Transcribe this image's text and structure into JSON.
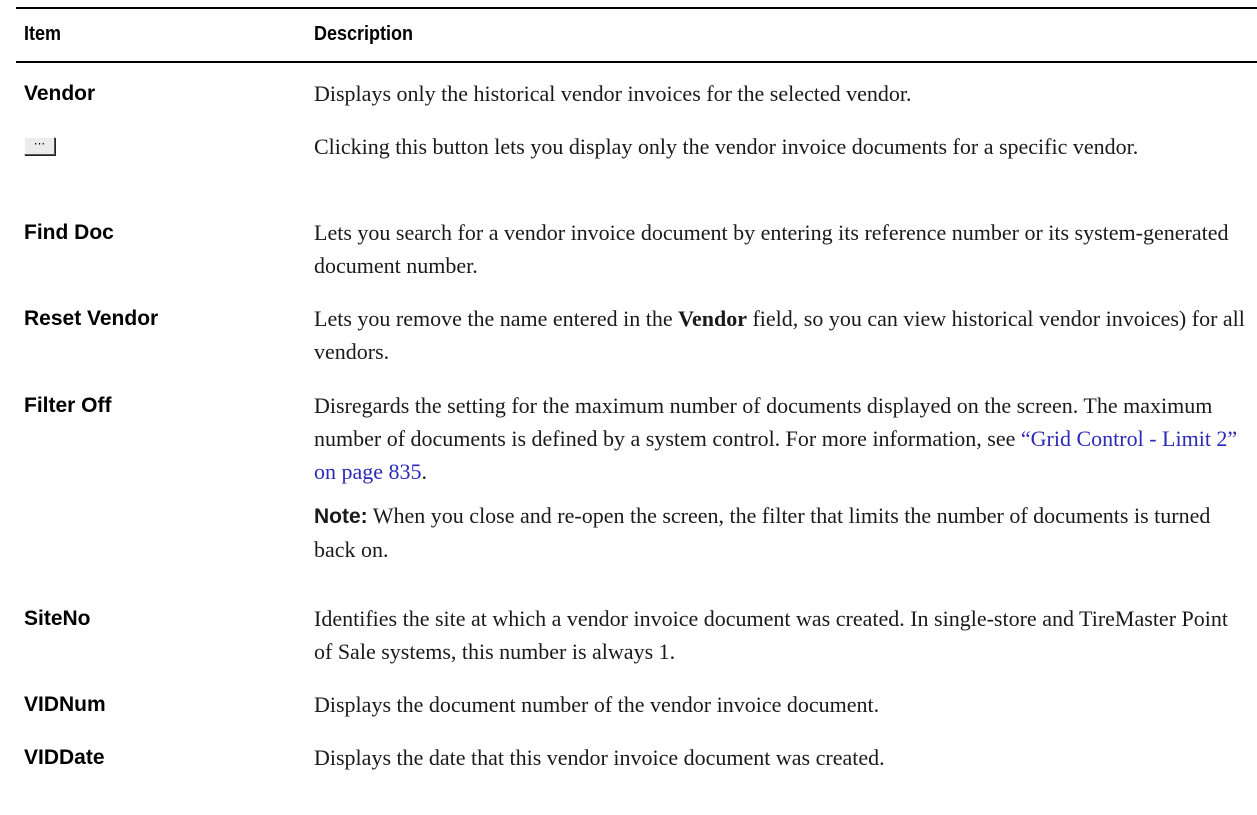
{
  "header": {
    "item": "Item",
    "description": "Description"
  },
  "rows": [
    {
      "term": "Vendor",
      "text": "Displays only the historical vendor invoices for the selected vendor."
    },
    {
      "button_icon": "ellipsis-button-icon",
      "button_glyph": "···",
      "text": "Clicking this button lets you display only the vendor invoice documents for a specific vendor."
    },
    {
      "term": "Find Doc",
      "text": "Lets you search for a vendor invoice document by entering its reference number or its system-generated document number."
    },
    {
      "term": "Reset Vendor",
      "text_before": "Lets you remove the name entered in the ",
      "text_bold": "Vendor",
      "text_after": " field, so you can view historical vendor invoices) for all vendors."
    },
    {
      "term": "Filter Off",
      "text": "Disregards the setting for the maximum number of documents displayed on the screen. The maximum number of documents is defined by a system control. For more information, see ",
      "link": "“Grid Control - Limit 2” on page 835",
      "text_end": ".",
      "note_label": "Note:",
      "note_text": " When you close and re-open the screen, the filter that limits the number of documents is turned back on."
    },
    {
      "term": "SiteNo",
      "text": "Identifies the site at which a vendor invoice document was created. In single-store and TireMaster Point of Sale systems, this number is always 1."
    },
    {
      "term": "VIDNum",
      "text": "Displays the document number of the vendor invoice document."
    },
    {
      "term": "VIDDate",
      "text": "Displays the date that this vendor invoice document was created."
    }
  ],
  "colors": {
    "link": "#2a2ab8",
    "text": "#1a1a1a",
    "rule": "#000000"
  }
}
